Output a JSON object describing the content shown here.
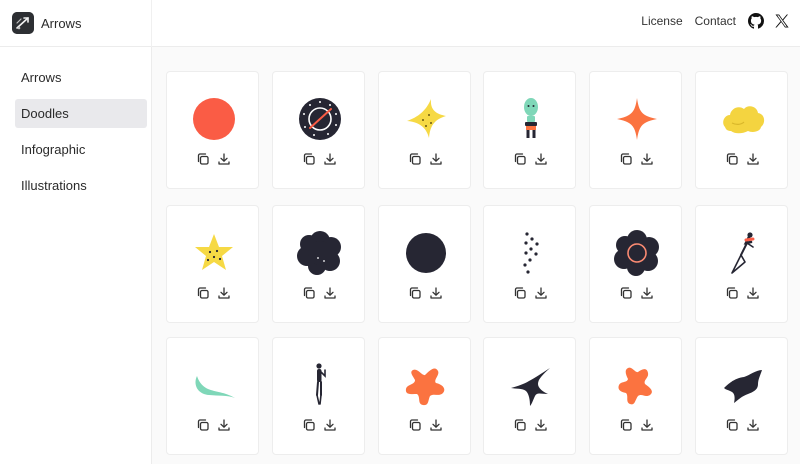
{
  "app": {
    "title": "Arrows"
  },
  "topnav": {
    "license": "License",
    "contact": "Contact"
  },
  "sidebar": {
    "items": [
      {
        "label": "Arrows",
        "active": false
      },
      {
        "label": "Doodles",
        "active": true
      },
      {
        "label": "Infographic",
        "active": false
      },
      {
        "label": "Illustrations",
        "active": false
      }
    ]
  },
  "doodles": [
    {
      "name": "red-circle",
      "color": "#fa5c45"
    },
    {
      "name": "compass-circle",
      "color": "#262633"
    },
    {
      "name": "yellow-sparkle",
      "color": "#f6d944"
    },
    {
      "name": "green-figure",
      "color": "#7fd7b8"
    },
    {
      "name": "orange-sparkle",
      "color": "#fb7340"
    },
    {
      "name": "yellow-cloud",
      "color": "#f4d440"
    },
    {
      "name": "yellow-star",
      "color": "#f6d944"
    },
    {
      "name": "dark-flower",
      "color": "#262633"
    },
    {
      "name": "dark-circle",
      "color": "#262633"
    },
    {
      "name": "scattered-dots",
      "color": "#262633"
    },
    {
      "name": "ringed-flower",
      "color": "#262633"
    },
    {
      "name": "flying-figure",
      "color": "#262633"
    },
    {
      "name": "green-crescent",
      "color": "#7fd7b8"
    },
    {
      "name": "standing-figure",
      "color": "#262633"
    },
    {
      "name": "orange-splat",
      "color": "#fb7340"
    },
    {
      "name": "dark-sparkle",
      "color": "#262633"
    },
    {
      "name": "orange-splat-2",
      "color": "#fb7340"
    },
    {
      "name": "dark-blob",
      "color": "#262633"
    }
  ],
  "icons": {
    "copy": "copy-icon",
    "download": "download-icon",
    "github": "github-icon",
    "x": "x-logo-icon"
  }
}
